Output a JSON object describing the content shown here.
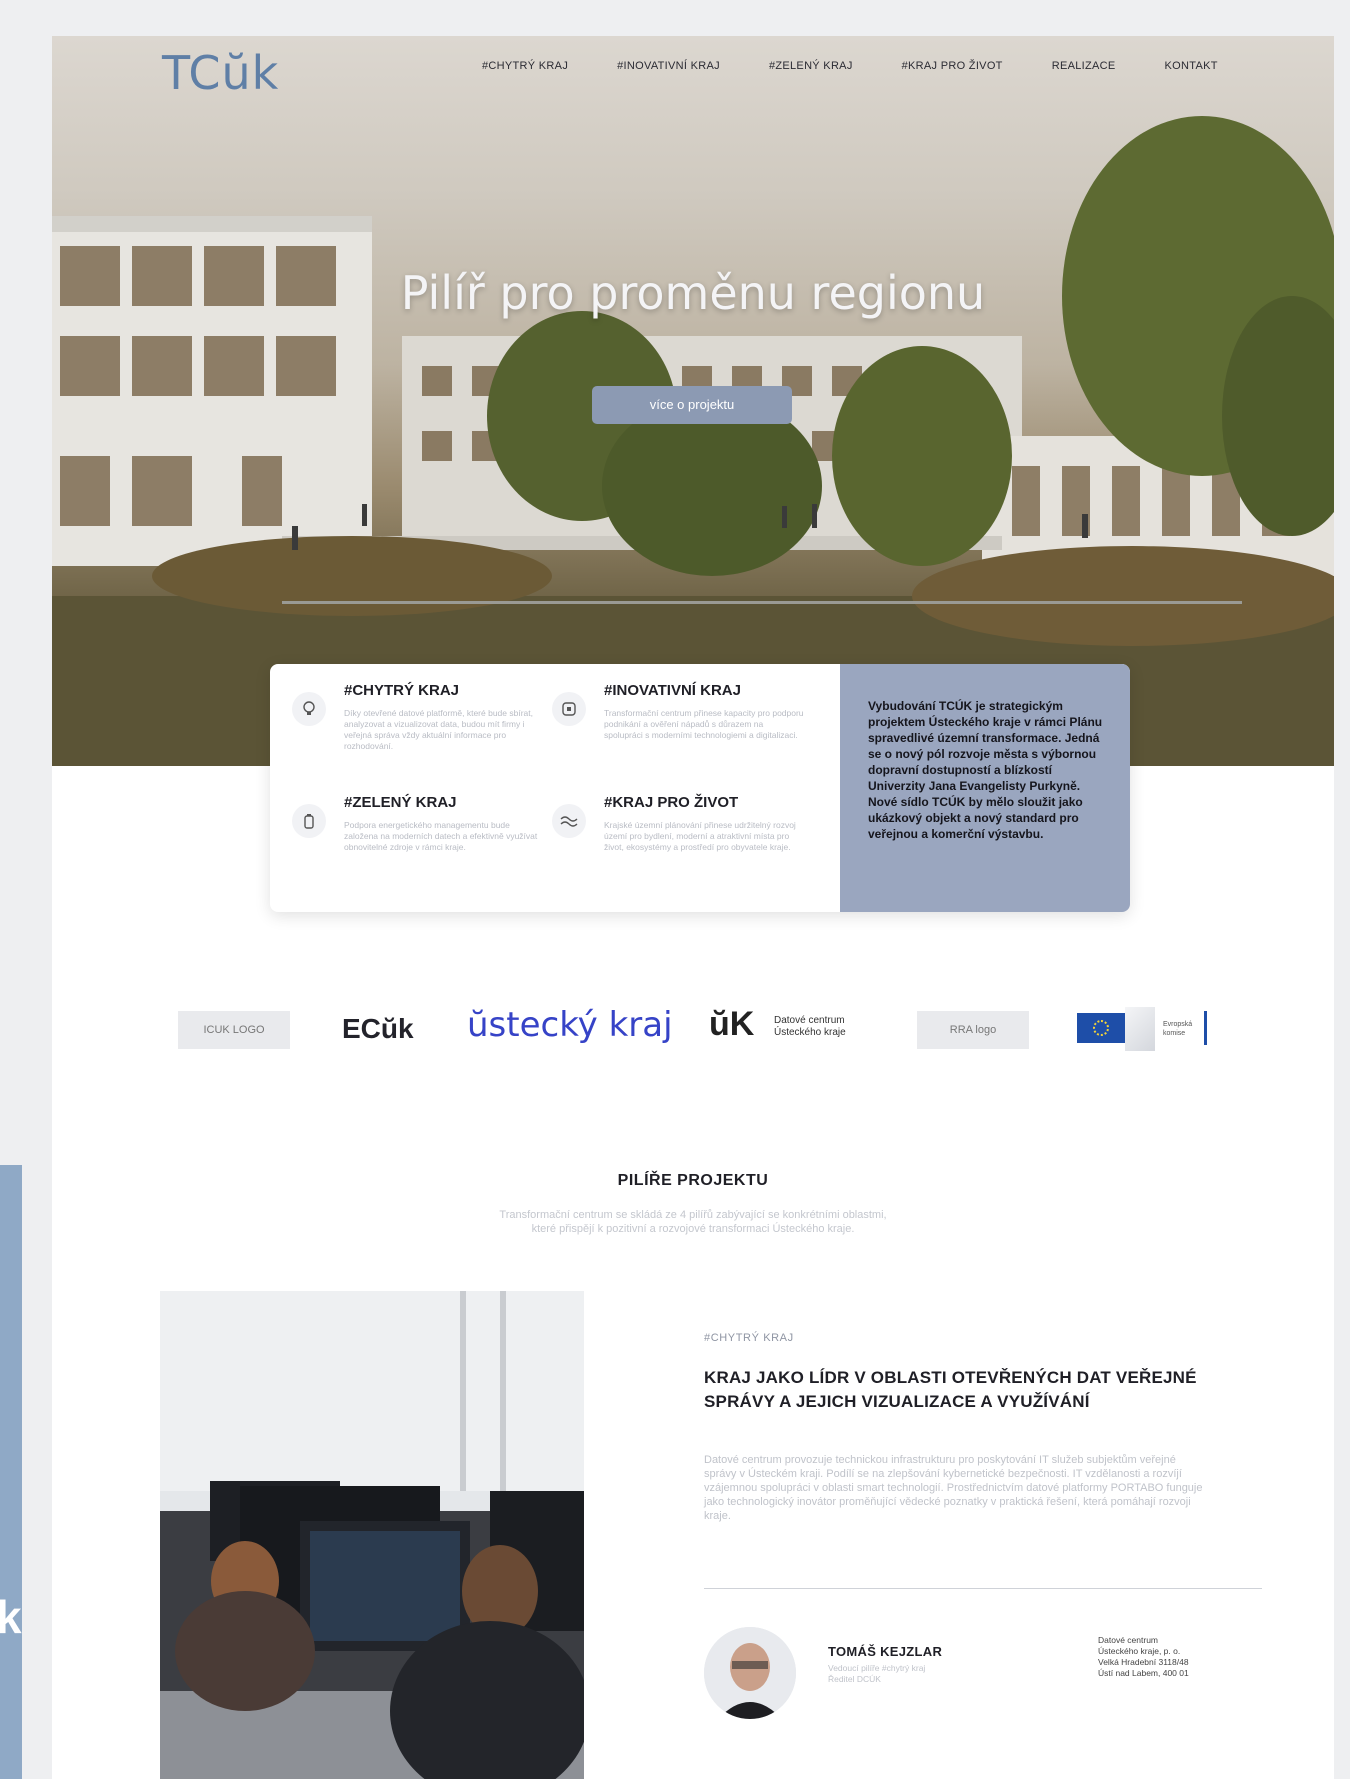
{
  "brand": {
    "logo_text": "TCŭk"
  },
  "nav": [
    "#CHYTRÝ KRAJ",
    "#INOVATIVNÍ KRAJ",
    "#ZELENÝ KRAJ",
    "#KRAJ PRO ŽIVOT",
    "REALIZACE",
    "KONTAKT"
  ],
  "hero": {
    "title": "Pilíř pro proměnu regionu",
    "button": "více o projektu"
  },
  "pillars": [
    {
      "title": "#CHYTRÝ KRAJ",
      "icon": "lightbulb-icon",
      "text": "Díky otevřené datové platformě, které bude sbírat, analyzovat a vizualizovat data, budou mít firmy i veřejná správa vždy aktuální informace pro rozhodování."
    },
    {
      "title": "#INOVATIVNÍ KRAJ",
      "icon": "chip-icon",
      "text": "Transformační centrum přinese kapacity pro podporu podnikání a ověření nápadů s důrazem na spolupráci s moderními technologiemi a digitalizaci."
    },
    {
      "title": "#ZELENÝ KRAJ",
      "icon": "battery-icon",
      "text": "Podpora energetického managementu bude založena na moderních datech a efektivně využívat obnovitelné zdroje v rámci kraje."
    },
    {
      "title": "#KRAJ PRO ŽIVOT",
      "icon": "waves-icon",
      "text": "Krajské územní plánování přinese udržitelný rozvoj území pro bydlení, moderní a atraktivní místa pro život, ekosystémy a prostředí pro obyvatele kraje."
    }
  ],
  "card_panel": {
    "text": "Vybudování TCÚK je strategickým projektem Ústeckého kraje v rámci Plánu spravedlivé územní transformace. Jedná se o nový pól rozvoje města s výbornou dopravní dostupností a blízkostí Univerzity Jana Evangelisty Purkyně. Nové sídlo TCÚK by mělo sloužit jako ukázkový objekt a nový standard pro veřejnou a komerční výstavbu."
  },
  "partners": {
    "tcuk_logo": "ICUK LOGO",
    "ecuk": "ECŭk",
    "kraj": "ŭstecký kraj",
    "uk": "ŭK",
    "uk_text_1": "Datové centrum",
    "uk_text_2": "Ústeckého kraje",
    "rra": "RRA logo",
    "eu_text_1": "Evropská",
    "eu_text_2": "komise"
  },
  "section": {
    "title": "PILÍŘE PROJEKTU",
    "text": "Transformační centrum se skládá ze 4 pilířů zabývající se konkrétními oblastmi, které přispějí k pozitivní a rozvojové transformaci Ústeckého kraje."
  },
  "feature": {
    "tag": "#CHYTRÝ KRAJ",
    "headline": "KRAJ JAKO LÍDR V OBLASTI OTEVŘENÝCH DAT VEŘEJNÉ SPRÁVY A JEJICH VIZUALIZACE A VYUŽÍVÁNÍ",
    "text": "Datové centrum provozuje technickou infrastrukturu pro poskytování IT služeb subjektům veřejné správy v Ústeckém kraji. Podílí se na zlepšování kybernetické bezpečnosti. IT vzdělanosti a rozvíjí vzájemnou spolupráci v oblasti smart technologií. Prostřednictvím datové platformy PORTABO funguje jako technologický inovátor proměňující vědecké poznatky v praktická řešení, která pomáhají rozvoji kraje."
  },
  "person": {
    "name": "TOMÁŠ KEJZLAR",
    "role_1": "Vedoucí pilíře #chytrý kraj",
    "role_2": "Ředitel DCÚK",
    "address_1": "Datové centrum",
    "address_2": "Ústeckého kraje, p. o.",
    "address_3": "Velká Hradební 3118/48",
    "address_4": "Ústí nad Labem, 400 01"
  },
  "sidebar": {
    "letter": "k"
  },
  "colors": {
    "accent": "#8c9ab3",
    "panel": "#9aa6bf",
    "logo": "#5f7fa6",
    "kraj_blue": "#3643c7",
    "left_bar": "#8fa9c6"
  }
}
